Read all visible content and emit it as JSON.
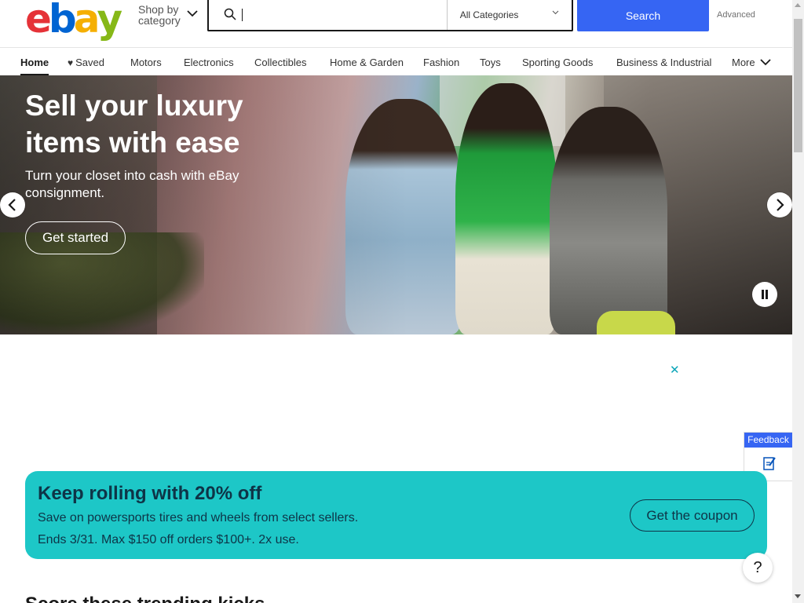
{
  "header": {
    "logo_letters": [
      {
        "char": "e",
        "color": "#e53238"
      },
      {
        "char": "b",
        "color": "#0064d2"
      },
      {
        "char": "a",
        "color": "#f5af02"
      },
      {
        "char": "y",
        "color": "#86b817"
      }
    ],
    "shop_by_line1": "Shop by",
    "shop_by_line2": "category",
    "search_placeholder": "",
    "category_select": "All Categories",
    "search_button": "Search",
    "advanced_link": "Advanced"
  },
  "nav": {
    "items": [
      {
        "label": "Home",
        "active": true
      },
      {
        "label": "Saved",
        "icon": "heart-icon"
      },
      {
        "label": "Motors"
      },
      {
        "label": "Electronics"
      },
      {
        "label": "Collectibles"
      },
      {
        "label": "Home & Garden"
      },
      {
        "label": "Fashion"
      },
      {
        "label": "Toys"
      },
      {
        "label": "Sporting Goods"
      },
      {
        "label": "Business & Industrial"
      },
      {
        "label": "More",
        "icon": "chevron-down-icon"
      }
    ]
  },
  "hero": {
    "title": "Sell your luxury items with ease",
    "subtitle": "Turn your closet into cash with eBay consignment.",
    "cta": "Get started",
    "prev_icon": "chevron-left-icon",
    "next_icon": "chevron-right-icon",
    "pause_icon": "pause-icon"
  },
  "ad": {
    "close_icon": "close-icon",
    "close_glyph": "✕"
  },
  "feedback": {
    "label": "Feedback",
    "icon": "feedback-edit-icon"
  },
  "promo": {
    "title": "Keep rolling with 20% off",
    "line1": "Save on powersports tires and wheels from select sellers.",
    "line2": "Ends 3/31. Max $150 off orders $100+. 2x use.",
    "cta": "Get the coupon",
    "bg_color": "#1dc7c7"
  },
  "help": {
    "glyph": "?"
  },
  "next_section": {
    "heading": "Score these trending kicks"
  },
  "colors": {
    "brand_blue": "#3665f3",
    "text": "#191919"
  }
}
